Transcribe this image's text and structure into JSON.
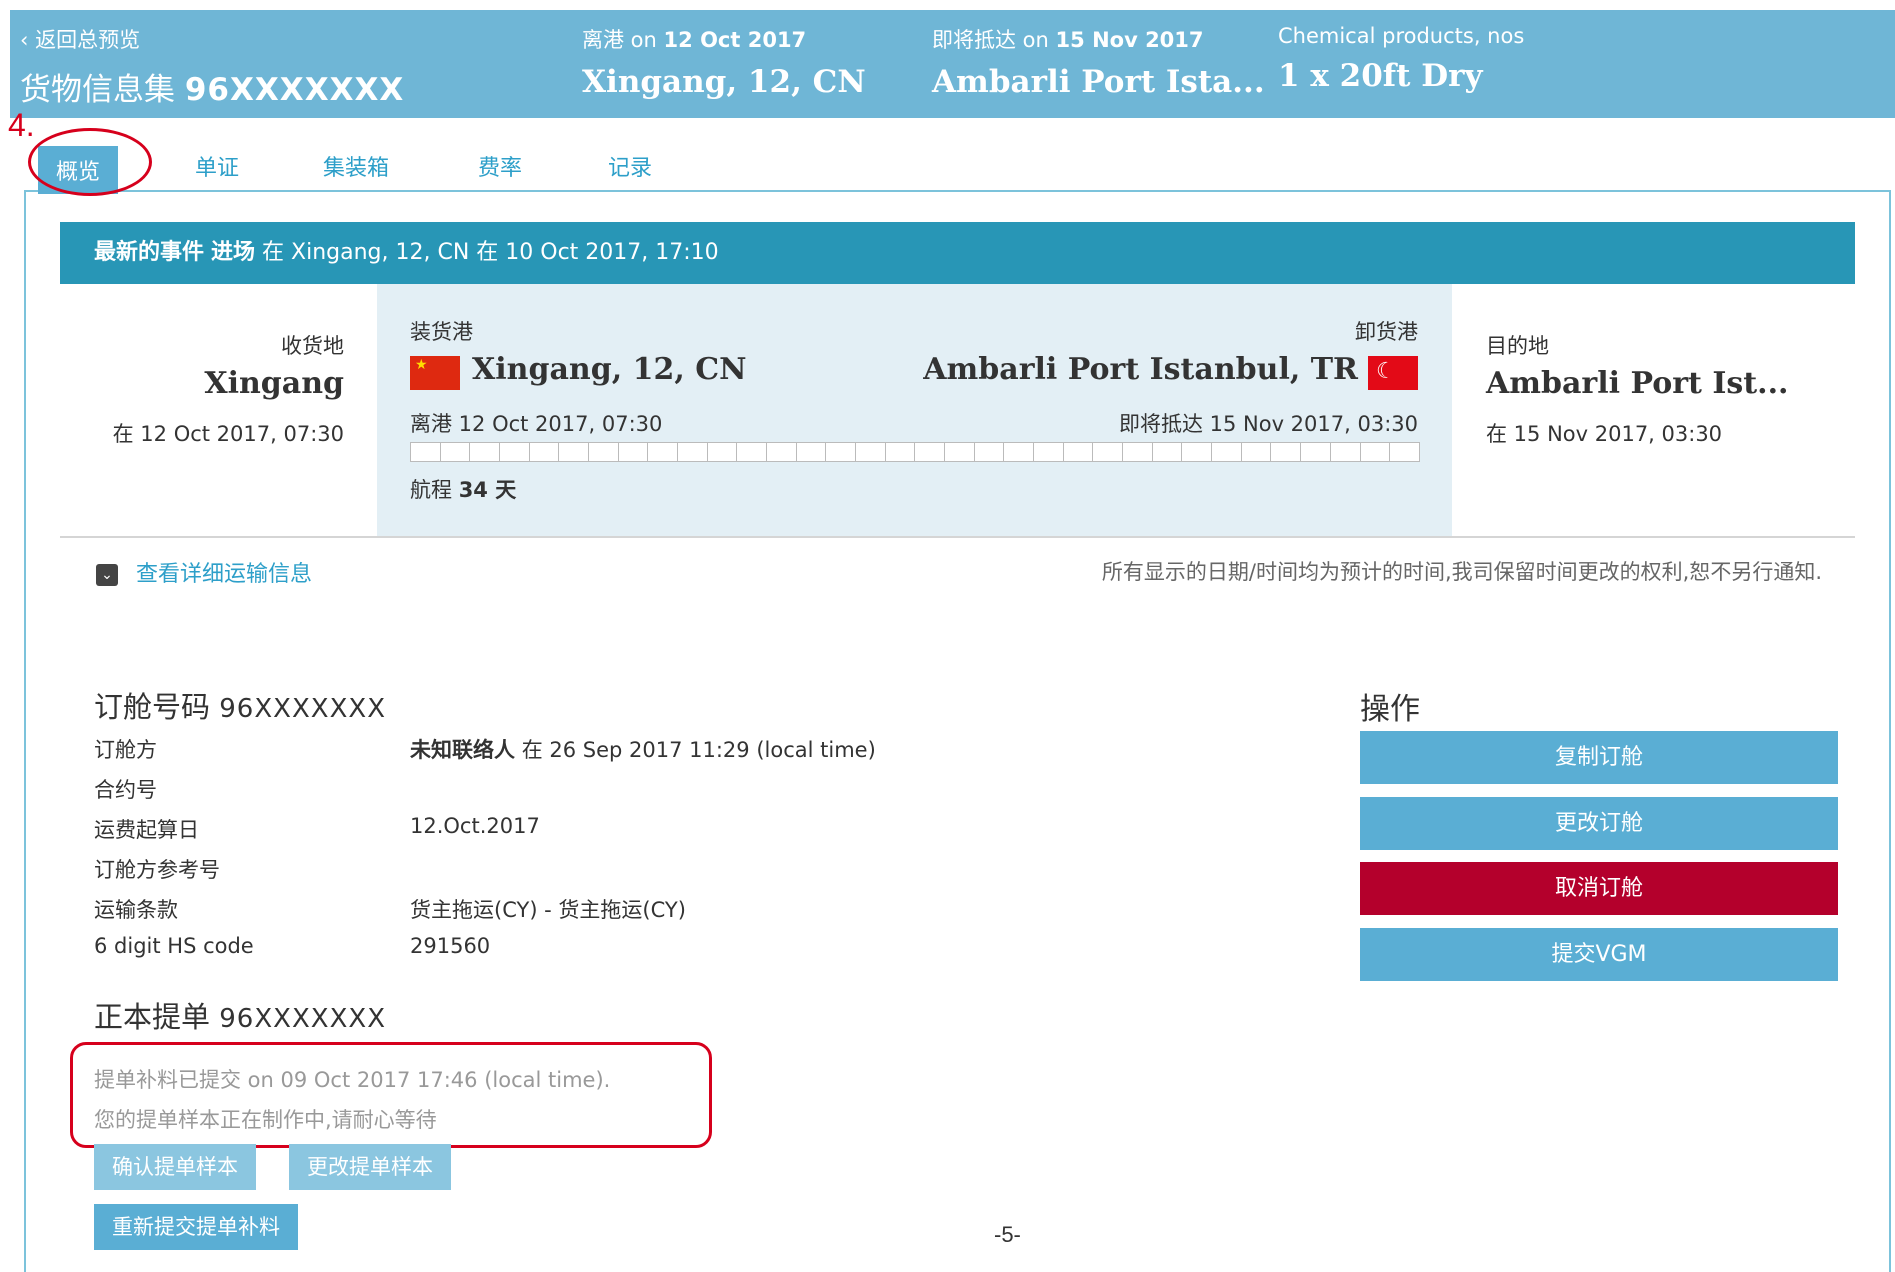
{
  "header": {
    "back_label": "‹ 返回总预览",
    "title_prefix": "货物信息集",
    "booking_number": "96XXXXXXX",
    "departure_label": "离港 on",
    "departure_date": "12 Oct 2017",
    "departure_place": "Xingang, 12, CN",
    "arrival_label": "即将抵达 on",
    "arrival_date": "15 Nov 2017",
    "arrival_place": "Ambarli Port Ista...",
    "commodity": "Chemical products, nos",
    "container": "1 x 20ft Dry"
  },
  "annotation": {
    "step_number": "4."
  },
  "tabs": [
    {
      "label": "概览",
      "active": true
    },
    {
      "label": "单证",
      "active": false
    },
    {
      "label": "集装箱",
      "active": false
    },
    {
      "label": "费率",
      "active": false
    },
    {
      "label": "记录",
      "active": false
    }
  ],
  "event": {
    "prefix": "最新的事件",
    "status": "进场",
    "rest": "在 Xingang, 12, CN 在 10 Oct 2017, 17:10"
  },
  "route": {
    "receipt": {
      "label": "收货地",
      "place": "Xingang",
      "date": "在 12 Oct 2017, 07:30"
    },
    "load_port": {
      "label": "装货港",
      "place": "Xingang, 12, CN",
      "date": "离港 12 Oct 2017, 07:30",
      "flag": "cn-flag"
    },
    "discharge_port": {
      "label": "卸货港",
      "place": "Ambarli Port Istanbul, TR",
      "date": "即将抵达 15 Nov 2017, 03:30",
      "flag": "tr-flag"
    },
    "destination": {
      "label": "目的地",
      "place": "Ambarli Port Ist...",
      "date": "在 15 Nov 2017, 03:30"
    },
    "voyage_label": "航程",
    "voyage_days": "34 天"
  },
  "details_link": "查看详细运输信息",
  "disclaimer": "所有显示的日期/时间均为预计的时间,我司保留时间更改的权利,恕不另行通知.",
  "booking": {
    "title": "订舱号码",
    "number": "96XXXXXXX",
    "rows": [
      {
        "key": "订舱方",
        "value_bold": "未知联络人",
        "value": "在 26 Sep 2017 11:29 (local time)"
      },
      {
        "key": "合约号",
        "value_bold": "",
        "value": ""
      },
      {
        "key": "运费起算日",
        "value_bold": "",
        "value": "12.Oct.2017"
      },
      {
        "key": "订舱方参考号",
        "value_bold": "",
        "value": ""
      },
      {
        "key": "运输条款",
        "value_bold": "",
        "value": "货主拖运(CY) - 货主拖运(CY)"
      },
      {
        "key": "6 digit HS code",
        "value_bold": "",
        "value": "291560"
      }
    ]
  },
  "operations": {
    "title": "操作",
    "buttons": [
      "复制订舱",
      "更改订舱",
      "取消订舱",
      "提交VGM"
    ]
  },
  "bill_of_lading": {
    "title": "正本提单",
    "number": "96XXXXXXX",
    "note1": "提单补料已提交 on 09 Oct 2017 17:46 (local time).",
    "note2": "您的提单样本正在制作中,请耐心等待",
    "confirm_button": "确认提单样本",
    "modify_button": "更改提单样本",
    "resubmit_button": "重新提交提单补料"
  },
  "page_number": "-5-",
  "colors": {
    "header": "#6fb6d6",
    "event_bar": "#2896b6",
    "button": "#5aaed4",
    "danger": "#b4002c",
    "annotation": "#d6001c"
  }
}
